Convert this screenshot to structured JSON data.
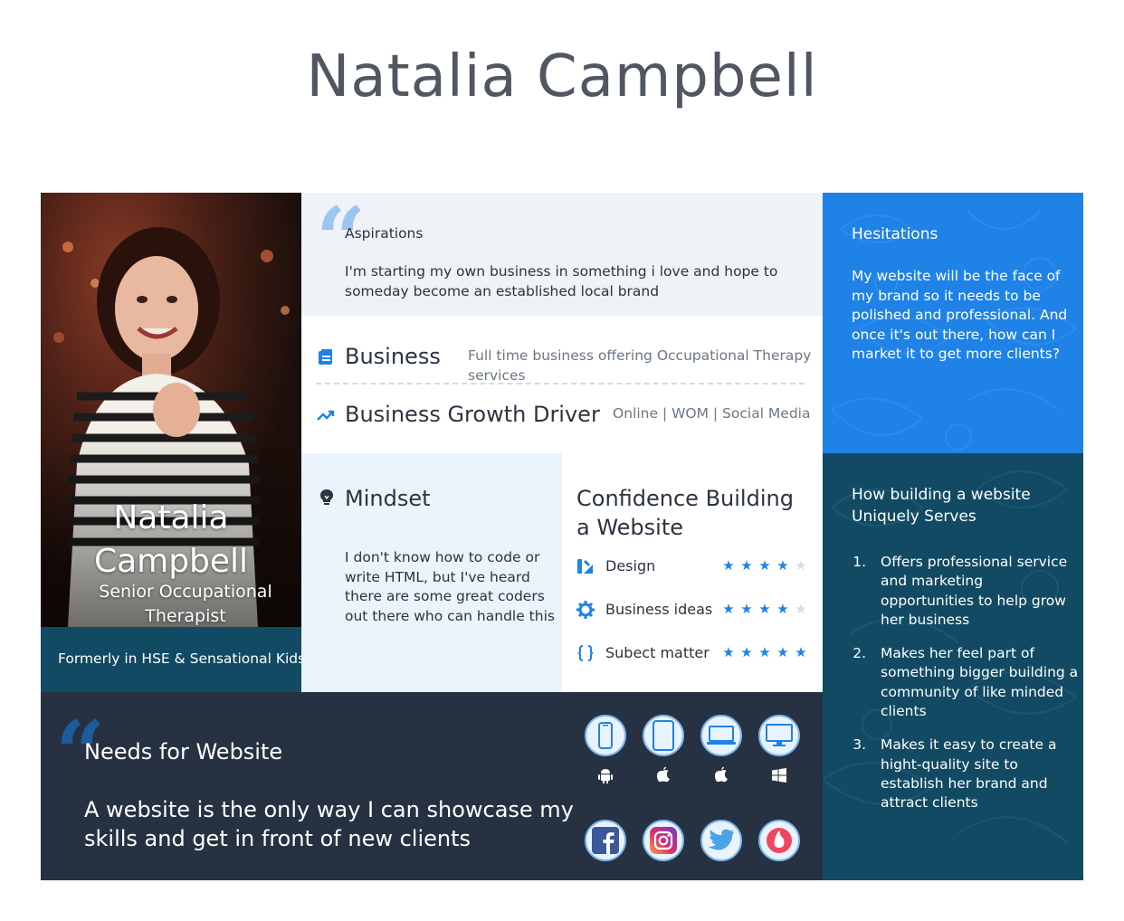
{
  "page_title": "Natalia Campbell",
  "profile": {
    "name": "Natalia Campbell",
    "role": "Senior Occupational Therapist",
    "former": "Formerly in HSE & Sensational Kids"
  },
  "aspirations": {
    "title": "Aspirations",
    "text": "I'm starting my own business in something i love and hope to someday become an established local brand"
  },
  "business": {
    "label": "Business",
    "value": "Full time business offering Occupational Therapy services",
    "growth_label": "Business Growth Driver",
    "growth_value": "Online | WOM | Social Media"
  },
  "hesitations": {
    "title": "Hesitations",
    "text": "My website will be the face of my brand so it needs to be polished and professional. And once it's out there, how can I market it to get more clients?"
  },
  "mindset": {
    "title": "Mindset",
    "text": "I don't know how to code or write HTML, but I've heard there are some great coders out there who can handle this"
  },
  "confidence": {
    "title": "Confidence Building a Website",
    "items": [
      {
        "label": "Design",
        "icon": "design-icon",
        "rating": 4,
        "max": 5
      },
      {
        "label": "Business ideas",
        "icon": "gear-icon",
        "rating": 4,
        "max": 5
      },
      {
        "label": "Subect matter",
        "icon": "code-braces-icon",
        "rating": 5,
        "max": 5
      }
    ]
  },
  "serves": {
    "title": "How building a website Uniquely Serves",
    "items": [
      {
        "num": "1.",
        "text": "Offers professional service and marketing opportunities to help grow her business"
      },
      {
        "num": "2.",
        "text": "Makes her feel part of something bigger building a community of like minded clients"
      },
      {
        "num": "3.",
        "text": "Makes it easy to create a hight-quality site to establish her brand and attract clients"
      }
    ]
  },
  "needs": {
    "title": "Needs for Website",
    "text_line1": "A website is the only way I can showcase my",
    "text_line2": "skills and get in front of new clients"
  },
  "devices": [
    "phone-icon",
    "tablet-icon",
    "laptop-icon",
    "desktop-icon"
  ],
  "platforms": [
    "android-icon",
    "apple-icon",
    "apple-icon",
    "windows-icon"
  ],
  "social": [
    "facebook-icon",
    "instagram-icon",
    "twitter-icon",
    "tinder-icon"
  ],
  "colors": {
    "blue": "#1e82e6",
    "teal": "#124a63",
    "navy": "#263241",
    "light_gray": "#eff2f6",
    "light_blue": "#eaf4fc"
  }
}
